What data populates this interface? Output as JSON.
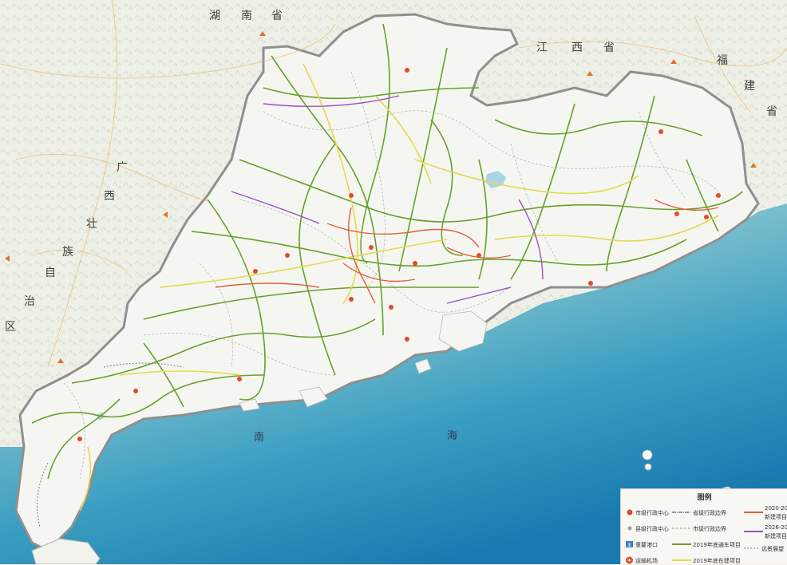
{
  "map": {
    "labels": {
      "hunan": [
        "湖",
        "南",
        "省"
      ],
      "jiangxi": [
        "江",
        "西",
        "省"
      ],
      "fujian": [
        "福",
        "建",
        "省"
      ],
      "guangxi": [
        "广",
        "西",
        "壮",
        "族",
        "自",
        "治",
        "区"
      ],
      "sea": [
        "南",
        "海"
      ]
    },
    "colors": {
      "land": "#eef0e8",
      "province_land": "#e7ece2",
      "sea_near": "#cfe6e6",
      "sea_far": "#1f83b4",
      "built_road": "#6a9e2a",
      "construction_road": "#e2da4e",
      "new_2020_road": "#e0603e",
      "new_2026_road": "#9a52c0",
      "boundary": "#9a9a9a"
    }
  },
  "legend": {
    "title": "图例",
    "items": {
      "city_center": "市级行政中心",
      "county_center": "县级行政中心",
      "port": "重要港口",
      "airport": "运输机场",
      "provincial_boundary": "省级行政边界",
      "city_boundary": "市级行政边界",
      "built_2019": "2019年底通车项目",
      "construction_2019": "2019年底在建项目",
      "new_2020": "2020-20",
      "new_2020_sub": "新建项目",
      "new_2026": "2026-20",
      "new_2026_sub": "新建项目",
      "outlook": "远景展望"
    }
  }
}
